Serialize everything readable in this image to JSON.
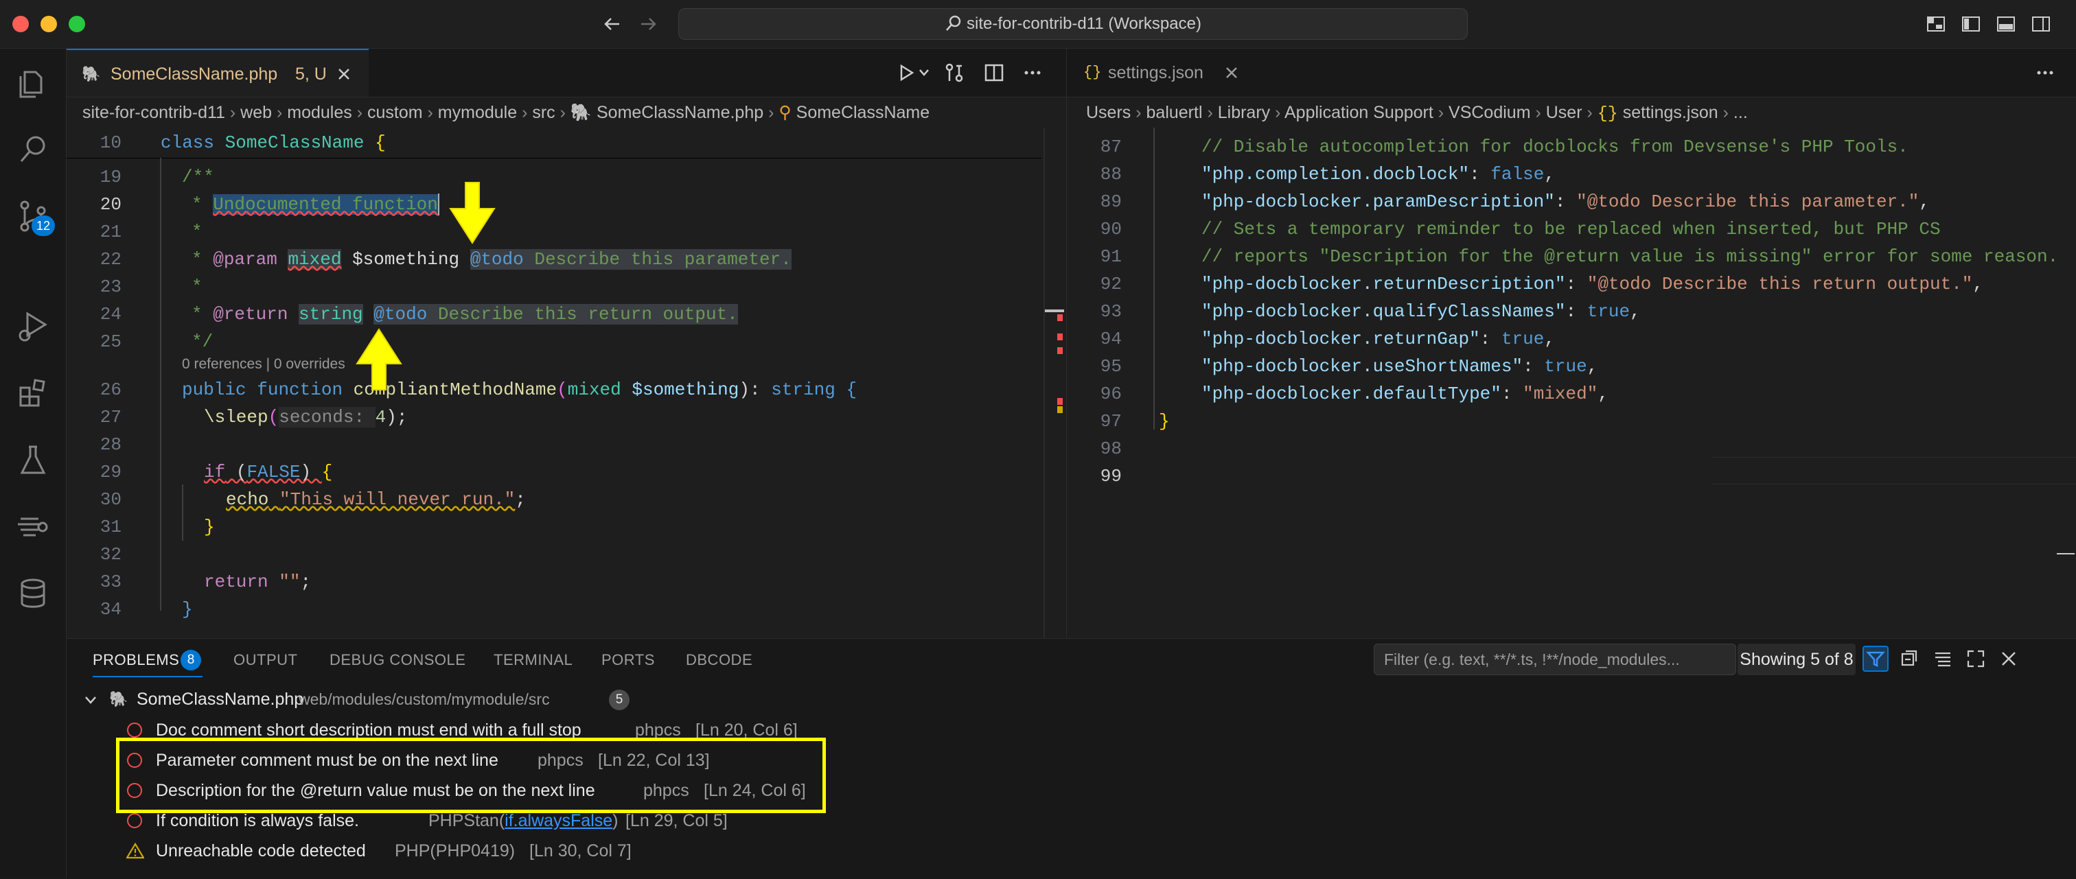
{
  "window": {
    "title": "site-for-contrib-d11 (Workspace)"
  },
  "activity_bar": {
    "scm_badge": "12"
  },
  "left_editor": {
    "tab": {
      "label": "SomeClassName.php",
      "status": "5, U"
    },
    "breadcrumb": [
      "site-for-contrib-d11",
      "web",
      "modules",
      "custom",
      "mymodule",
      "src",
      "SomeClassName.php",
      "SomeClassName"
    ],
    "sticky": {
      "number": "10",
      "kw": "class",
      "name": "SomeClassName",
      "brace": "{"
    },
    "lines": {
      "n19": "19",
      "n20": "20",
      "n21": "21",
      "n22": "22",
      "n23": "23",
      "n24": "24",
      "n25": "25",
      "n26": "26",
      "n27": "27",
      "n28": "28",
      "n29": "29",
      "n30": "30",
      "n31": "31",
      "n32": "32",
      "n33": "33",
      "n34": "34",
      "l19": "/**",
      "l20_star": "* ",
      "l20_text": "Undocumented function",
      "l21": "*",
      "l22_star": "* ",
      "l22_param": "@param",
      "l22_type": "mixed",
      "l22_var": "$something",
      "l22_todo": "@todo",
      "l22_desc": "Describe this parameter.",
      "l23": "*",
      "l24_star": "* ",
      "l24_return": "@return",
      "l24_type": "string",
      "l24_todo": "@todo",
      "l24_desc": "Describe this return output.",
      "l25": "*/",
      "codelens": "0 references | 0 overrides",
      "l26_public": "public",
      "l26_function": "function",
      "l26_name": "compliantMethodName",
      "l26_open": "(",
      "l26_type": "mixed",
      "l26_var": "$something",
      "l26_close": "): ",
      "l26_ret": "string",
      "l26_brace": "{",
      "l27_fn": "\\sleep",
      "l27_open": "(",
      "l27_hint": "seconds: ",
      "l27_num": "4",
      "l27_close": ");",
      "l29_if": "if",
      "l29_open": " (",
      "l29_false": "FALSE",
      "l29_close": ") ",
      "l29_brace": "{",
      "l30_echo": "echo",
      "l30_str": "\"This will never run.\"",
      "l30_semi": ";",
      "l31": "}",
      "l33_return": "return",
      "l33_str": "\"\"",
      "l33_semi": ";",
      "l34": "}"
    }
  },
  "right_editor": {
    "tab": {
      "icon": "{}",
      "label": "settings.json"
    },
    "breadcrumb": [
      "Users",
      "baluertl",
      "Library",
      "Application Support",
      "VSCodium",
      "User",
      "settings.json",
      "..."
    ],
    "lines": [
      {
        "n": "87",
        "comment": "// Disable autocompletion for docblocks from Devsense's PHP Tools."
      },
      {
        "n": "88",
        "key": "\"php.completion.docblock\"",
        "val": "false",
        "val_type": "bool"
      },
      {
        "n": "89",
        "key": "\"php-docblocker.paramDescription\"",
        "val": "\"@todo Describe this parameter.\"",
        "val_type": "str"
      },
      {
        "n": "90",
        "comment": "// Sets a temporary reminder to be replaced when inserted, but PHP CS"
      },
      {
        "n": "91",
        "comment": "// reports \"Description for the @return value is missing\" error for some reason."
      },
      {
        "n": "92",
        "key": "\"php-docblocker.returnDescription\"",
        "val": "\"@todo Describe this return output.\"",
        "val_type": "str"
      },
      {
        "n": "93",
        "key": "\"php-docblocker.qualifyClassNames\"",
        "val": "true",
        "val_type": "bool"
      },
      {
        "n": "94",
        "key": "\"php-docblocker.returnGap\"",
        "val": "true",
        "val_type": "bool"
      },
      {
        "n": "95",
        "key": "\"php-docblocker.useShortNames\"",
        "val": "true",
        "val_type": "bool"
      },
      {
        "n": "96",
        "key": "\"php-docblocker.defaultType\"",
        "val": "\"mixed\"",
        "val_type": "str"
      },
      {
        "n": "97",
        "brace": "}"
      },
      {
        "n": "98"
      },
      {
        "n": "99"
      }
    ]
  },
  "panel": {
    "tabs": [
      "PROBLEMS",
      "OUTPUT",
      "DEBUG CONSOLE",
      "TERMINAL",
      "PORTS",
      "DBCODE"
    ],
    "problems_badge": "8",
    "filter_placeholder": "Filter (e.g. text, **/*.ts, !**/node_modules...",
    "showing": "Showing 5 of 8",
    "file": {
      "name": "SomeClassName.php",
      "path": "web/modules/custom/mymodule/src",
      "count": "5"
    },
    "problems": [
      {
        "severity": "error",
        "message": "Doc comment short description must end with a full stop",
        "source": "phpcs",
        "location": "[Ln 20, Col 6]"
      },
      {
        "severity": "error",
        "message": "Parameter comment must be on the next line",
        "source": "phpcs",
        "location": "[Ln 22, Col 13]"
      },
      {
        "severity": "error",
        "message": "Description for the @return value must be on the next line",
        "source": "phpcs",
        "location": "[Ln 24, Col 6]"
      },
      {
        "severity": "error",
        "message": "If condition is always false.",
        "source": "PHPStan(",
        "link": "if.alwaysFalse",
        "source_end": ")",
        "location": "[Ln 29, Col 5]"
      },
      {
        "severity": "warning",
        "message": "Unreachable code detected",
        "source": "PHP(PHP0419)",
        "location": "[Ln 30, Col 7]"
      }
    ]
  },
  "colors": {
    "accent": "#0078d4",
    "annotation": "#ffff00",
    "error": "#f14c4c",
    "warning": "#cca700"
  }
}
